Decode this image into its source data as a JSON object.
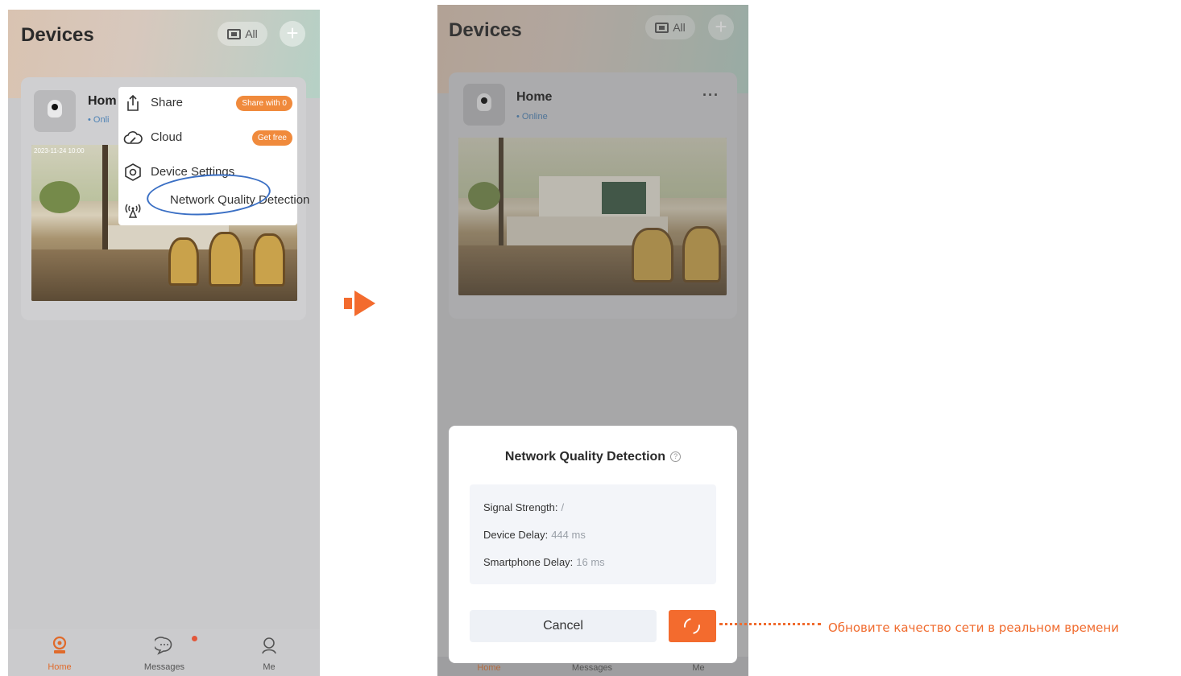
{
  "left_phone": {
    "title": "Devices",
    "filter_label": "All",
    "device": {
      "name": "Hom",
      "status": "Onli",
      "timestamp": "2023-11-24 10:00"
    },
    "menu": {
      "share_label": "Share",
      "share_badge": "Share with 0",
      "cloud_label": "Cloud",
      "cloud_badge": "Get free",
      "settings_label": "Device Settings",
      "network_label": "Network Quality Detection"
    },
    "tabs": [
      {
        "label": "Home",
        "icon": "home-camera-icon",
        "active": true
      },
      {
        "label": "Messages",
        "icon": "chat-icon",
        "active": false
      },
      {
        "label": "Me",
        "icon": "user-icon",
        "active": false
      }
    ]
  },
  "right_phone": {
    "title": "Devices",
    "filter_label": "All",
    "device": {
      "name": "Home",
      "status": "Online",
      "more_label": "···"
    },
    "dialog": {
      "title": "Network Quality Detection",
      "help_icon": "?",
      "signal_label": "Signal Strength:",
      "signal_value": "/",
      "device_delay_label": "Device Delay:",
      "device_delay_value": "444 ms",
      "phone_delay_label": "Smartphone Delay:",
      "phone_delay_value": "16 ms",
      "cancel_label": "Cancel",
      "refresh_icon": "refresh-icon"
    },
    "tabs": [
      {
        "label": "Home"
      },
      {
        "label": "Messages"
      },
      {
        "label": "Me"
      }
    ]
  },
  "annotation": {
    "text": "Обновите качество сети в реальном времени"
  },
  "colors": {
    "accent": "#f36b2e",
    "highlight_ellipse": "#3a6fc4",
    "annotation": "#f06b2e"
  }
}
